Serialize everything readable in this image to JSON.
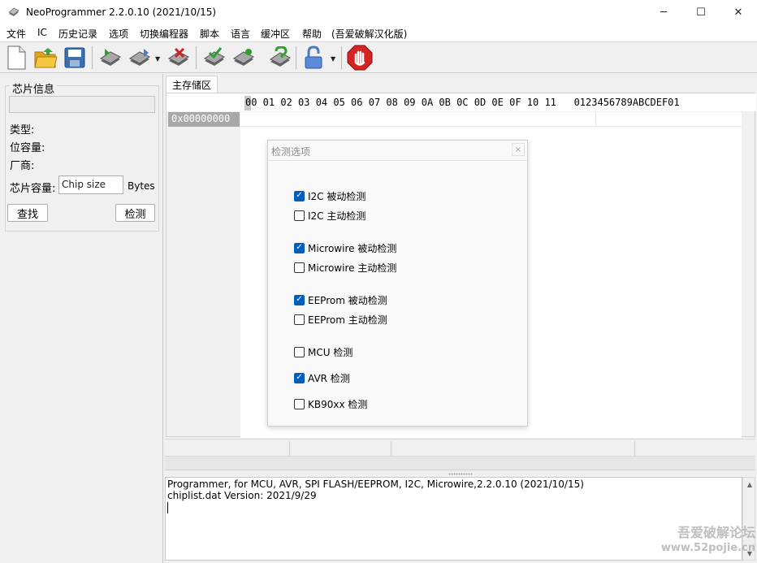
{
  "window": {
    "title": "NeoProgrammer 2.2.0.10 (2021/10/15)",
    "controls": {
      "minimize": "─",
      "maximize": "☐",
      "close": "✕"
    }
  },
  "menu": [
    "文件",
    "IC",
    "历史记录",
    "选项",
    "切换编程器",
    "脚本",
    "语言",
    "缓冲区",
    "帮助",
    "(吾爱破解汉化版)"
  ],
  "toolbar": {
    "icons": [
      "new-file-icon",
      "open-folder-icon",
      "save-disk-icon",
      "read-chip-icon",
      "write-chip-icon",
      "erase-chip-icon",
      "verify-chip-icon",
      "auto-chip-icon",
      "detect-chip-icon",
      "lock-icon",
      "stop-icon"
    ]
  },
  "left_panel": {
    "group_title": "芯片信息",
    "type_label": "类型:",
    "bit_capacity_label": "位容量:",
    "vendor_label": "厂商:",
    "chip_capacity_label": "芯片容量:",
    "chip_size_placeholder": "Chip size",
    "bytes_label": "Bytes",
    "find_button": "查找",
    "detect_button": "检测"
  },
  "memory_tab": {
    "label": "主存储区",
    "hex_header": "00 01 02 03 04 05 06 07 08 09 0A 0B 0C 0D 0E 0F 10 11   0123456789ABCDEF01",
    "first_address": "0x00000000"
  },
  "dialog": {
    "title": "检测选项",
    "close": "×",
    "options": [
      {
        "label": "I2C 被动检测",
        "checked": true
      },
      {
        "label": "I2C 主动检测",
        "checked": false
      },
      {
        "label": "Microwire 被动检测",
        "checked": true
      },
      {
        "label": "Microwire 主动检测",
        "checked": false
      },
      {
        "label": "EEProm 被动检测",
        "checked": true
      },
      {
        "label": "EEProm 主动检测",
        "checked": false
      },
      {
        "label": "MCU 检测",
        "checked": false
      },
      {
        "label": "AVR 检测",
        "checked": true
      },
      {
        "label": "KB90xx 检测",
        "checked": false
      }
    ]
  },
  "log": {
    "lines": [
      "Programmer, for MCU, AVR, SPI FLASH/EEPROM, I2C, Microwire,2.2.0.10 (2021/10/15)",
      "chiplist.dat Version: 2021/9/29"
    ]
  },
  "watermark": {
    "line1": "吾爱破解论坛",
    "line2": "www.52pojie.cn"
  },
  "colors": {
    "accent": "#005fb8",
    "address_cell": "#a8a8a8"
  }
}
